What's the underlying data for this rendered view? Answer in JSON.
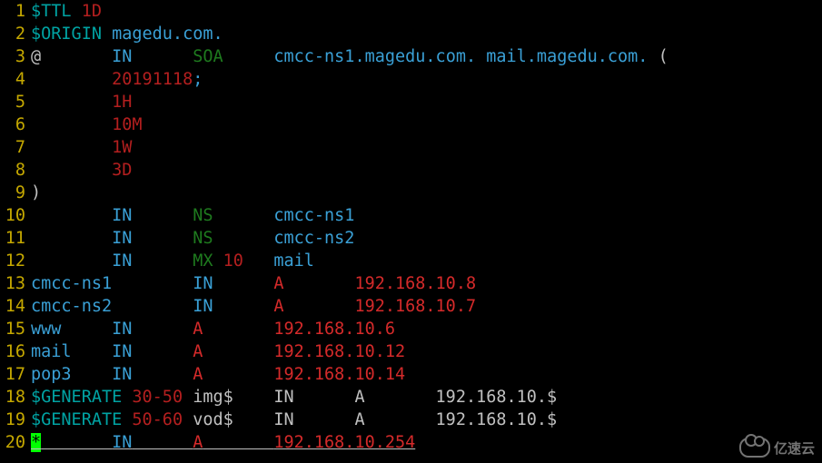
{
  "watermark": "亿速云",
  "lines": [
    {
      "n": 1,
      "tokens": [
        {
          "t": "$TTL",
          "c": "c-teal"
        },
        {
          "t": " ",
          "c": "c-white"
        },
        {
          "t": "1D",
          "c": "c-red"
        }
      ]
    },
    {
      "n": 2,
      "tokens": [
        {
          "t": "$ORIGIN",
          "c": "c-teal"
        },
        {
          "t": " ",
          "c": "c-white"
        },
        {
          "t": "magedu.com.",
          "c": "c-cyan"
        }
      ]
    },
    {
      "n": 3,
      "tokens": [
        {
          "t": "@       ",
          "c": "c-white"
        },
        {
          "t": "IN",
          "c": "c-cyan"
        },
        {
          "t": "      ",
          "c": "c-white"
        },
        {
          "t": "SOA",
          "c": "c-green"
        },
        {
          "t": "     ",
          "c": "c-white"
        },
        {
          "t": "cmcc-ns1.magedu.com. mail.magedu.com. ",
          "c": "c-cyan"
        },
        {
          "t": "(",
          "c": "c-white"
        }
      ]
    },
    {
      "n": 4,
      "tokens": [
        {
          "t": "        ",
          "c": "c-white"
        },
        {
          "t": "20191118",
          "c": "c-red"
        },
        {
          "t": ";",
          "c": "c-cyan"
        }
      ]
    },
    {
      "n": 5,
      "tokens": [
        {
          "t": "        ",
          "c": "c-white"
        },
        {
          "t": "1H",
          "c": "c-red"
        }
      ]
    },
    {
      "n": 6,
      "tokens": [
        {
          "t": "        ",
          "c": "c-white"
        },
        {
          "t": "10M",
          "c": "c-red"
        }
      ]
    },
    {
      "n": 7,
      "tokens": [
        {
          "t": "        ",
          "c": "c-white"
        },
        {
          "t": "1W",
          "c": "c-red"
        }
      ]
    },
    {
      "n": 8,
      "tokens": [
        {
          "t": "        ",
          "c": "c-white"
        },
        {
          "t": "3D",
          "c": "c-red"
        }
      ]
    },
    {
      "n": 9,
      "tokens": [
        {
          "t": ")",
          "c": "c-white"
        }
      ]
    },
    {
      "n": 10,
      "tokens": [
        {
          "t": "        ",
          "c": "c-white"
        },
        {
          "t": "IN",
          "c": "c-cyan"
        },
        {
          "t": "      ",
          "c": "c-white"
        },
        {
          "t": "NS",
          "c": "c-green"
        },
        {
          "t": "      ",
          "c": "c-white"
        },
        {
          "t": "cmcc-ns1",
          "c": "c-cyan"
        }
      ]
    },
    {
      "n": 11,
      "tokens": [
        {
          "t": "        ",
          "c": "c-white"
        },
        {
          "t": "IN",
          "c": "c-cyan"
        },
        {
          "t": "      ",
          "c": "c-white"
        },
        {
          "t": "NS",
          "c": "c-green"
        },
        {
          "t": "      ",
          "c": "c-white"
        },
        {
          "t": "cmcc-ns2",
          "c": "c-cyan"
        }
      ]
    },
    {
      "n": 12,
      "tokens": [
        {
          "t": "        ",
          "c": "c-white"
        },
        {
          "t": "IN",
          "c": "c-cyan"
        },
        {
          "t": "      ",
          "c": "c-white"
        },
        {
          "t": "MX",
          "c": "c-green"
        },
        {
          "t": " ",
          "c": "c-white"
        },
        {
          "t": "10",
          "c": "c-red"
        },
        {
          "t": "   ",
          "c": "c-white"
        },
        {
          "t": "mail",
          "c": "c-cyan"
        }
      ]
    },
    {
      "n": 13,
      "tokens": [
        {
          "t": "cmcc-ns1",
          "c": "c-cyan"
        },
        {
          "t": "        ",
          "c": "c-white"
        },
        {
          "t": "IN",
          "c": "c-cyan"
        },
        {
          "t": "      ",
          "c": "c-white"
        },
        {
          "t": "A",
          "c": "c-bred"
        },
        {
          "t": "       ",
          "c": "c-white"
        },
        {
          "t": "192.168.10.8",
          "c": "c-bred"
        }
      ]
    },
    {
      "n": 14,
      "tokens": [
        {
          "t": "cmcc-ns2",
          "c": "c-cyan"
        },
        {
          "t": "        ",
          "c": "c-white"
        },
        {
          "t": "IN",
          "c": "c-cyan"
        },
        {
          "t": "      ",
          "c": "c-white"
        },
        {
          "t": "A",
          "c": "c-bred"
        },
        {
          "t": "       ",
          "c": "c-white"
        },
        {
          "t": "192.168.10.7",
          "c": "c-bred"
        }
      ]
    },
    {
      "n": 15,
      "tokens": [
        {
          "t": "www",
          "c": "c-cyan"
        },
        {
          "t": "     ",
          "c": "c-white"
        },
        {
          "t": "IN",
          "c": "c-cyan"
        },
        {
          "t": "      ",
          "c": "c-white"
        },
        {
          "t": "A",
          "c": "c-bred"
        },
        {
          "t": "       ",
          "c": "c-white"
        },
        {
          "t": "192.168.10.6",
          "c": "c-bred"
        }
      ]
    },
    {
      "n": 16,
      "tokens": [
        {
          "t": "mail",
          "c": "c-cyan"
        },
        {
          "t": "    ",
          "c": "c-white"
        },
        {
          "t": "IN",
          "c": "c-cyan"
        },
        {
          "t": "      ",
          "c": "c-white"
        },
        {
          "t": "A",
          "c": "c-bred"
        },
        {
          "t": "       ",
          "c": "c-white"
        },
        {
          "t": "192.168.10.12",
          "c": "c-bred"
        }
      ]
    },
    {
      "n": 17,
      "tokens": [
        {
          "t": "pop3",
          "c": "c-cyan"
        },
        {
          "t": "    ",
          "c": "c-white"
        },
        {
          "t": "IN",
          "c": "c-cyan"
        },
        {
          "t": "      ",
          "c": "c-white"
        },
        {
          "t": "A",
          "c": "c-bred"
        },
        {
          "t": "       ",
          "c": "c-white"
        },
        {
          "t": "192.168.10.14",
          "c": "c-bred"
        }
      ]
    },
    {
      "n": 18,
      "tokens": [
        {
          "t": "$GENERATE",
          "c": "c-teal"
        },
        {
          "t": " ",
          "c": "c-white"
        },
        {
          "t": "30-50",
          "c": "c-red"
        },
        {
          "t": " img$    IN      A       192.168.10.$",
          "c": "c-white"
        }
      ]
    },
    {
      "n": 19,
      "tokens": [
        {
          "t": "$GENERATE",
          "c": "c-teal"
        },
        {
          "t": " ",
          "c": "c-white"
        },
        {
          "t": "50-60",
          "c": "c-red"
        },
        {
          "t": " vod$    IN      A       192.168.10.$",
          "c": "c-white"
        }
      ]
    },
    {
      "n": 20,
      "cursor": true,
      "tokens": [
        {
          "t": "*",
          "c": "cursor",
          "u": true
        },
        {
          "t": "       ",
          "c": "c-white",
          "u": true
        },
        {
          "t": "IN",
          "c": "c-cyan",
          "u": true
        },
        {
          "t": "      ",
          "c": "c-white",
          "u": true
        },
        {
          "t": "A",
          "c": "c-bred",
          "u": true
        },
        {
          "t": "       ",
          "c": "c-white",
          "u": true
        },
        {
          "t": "192.168.10.254",
          "c": "c-bred",
          "u": true
        }
      ]
    }
  ]
}
